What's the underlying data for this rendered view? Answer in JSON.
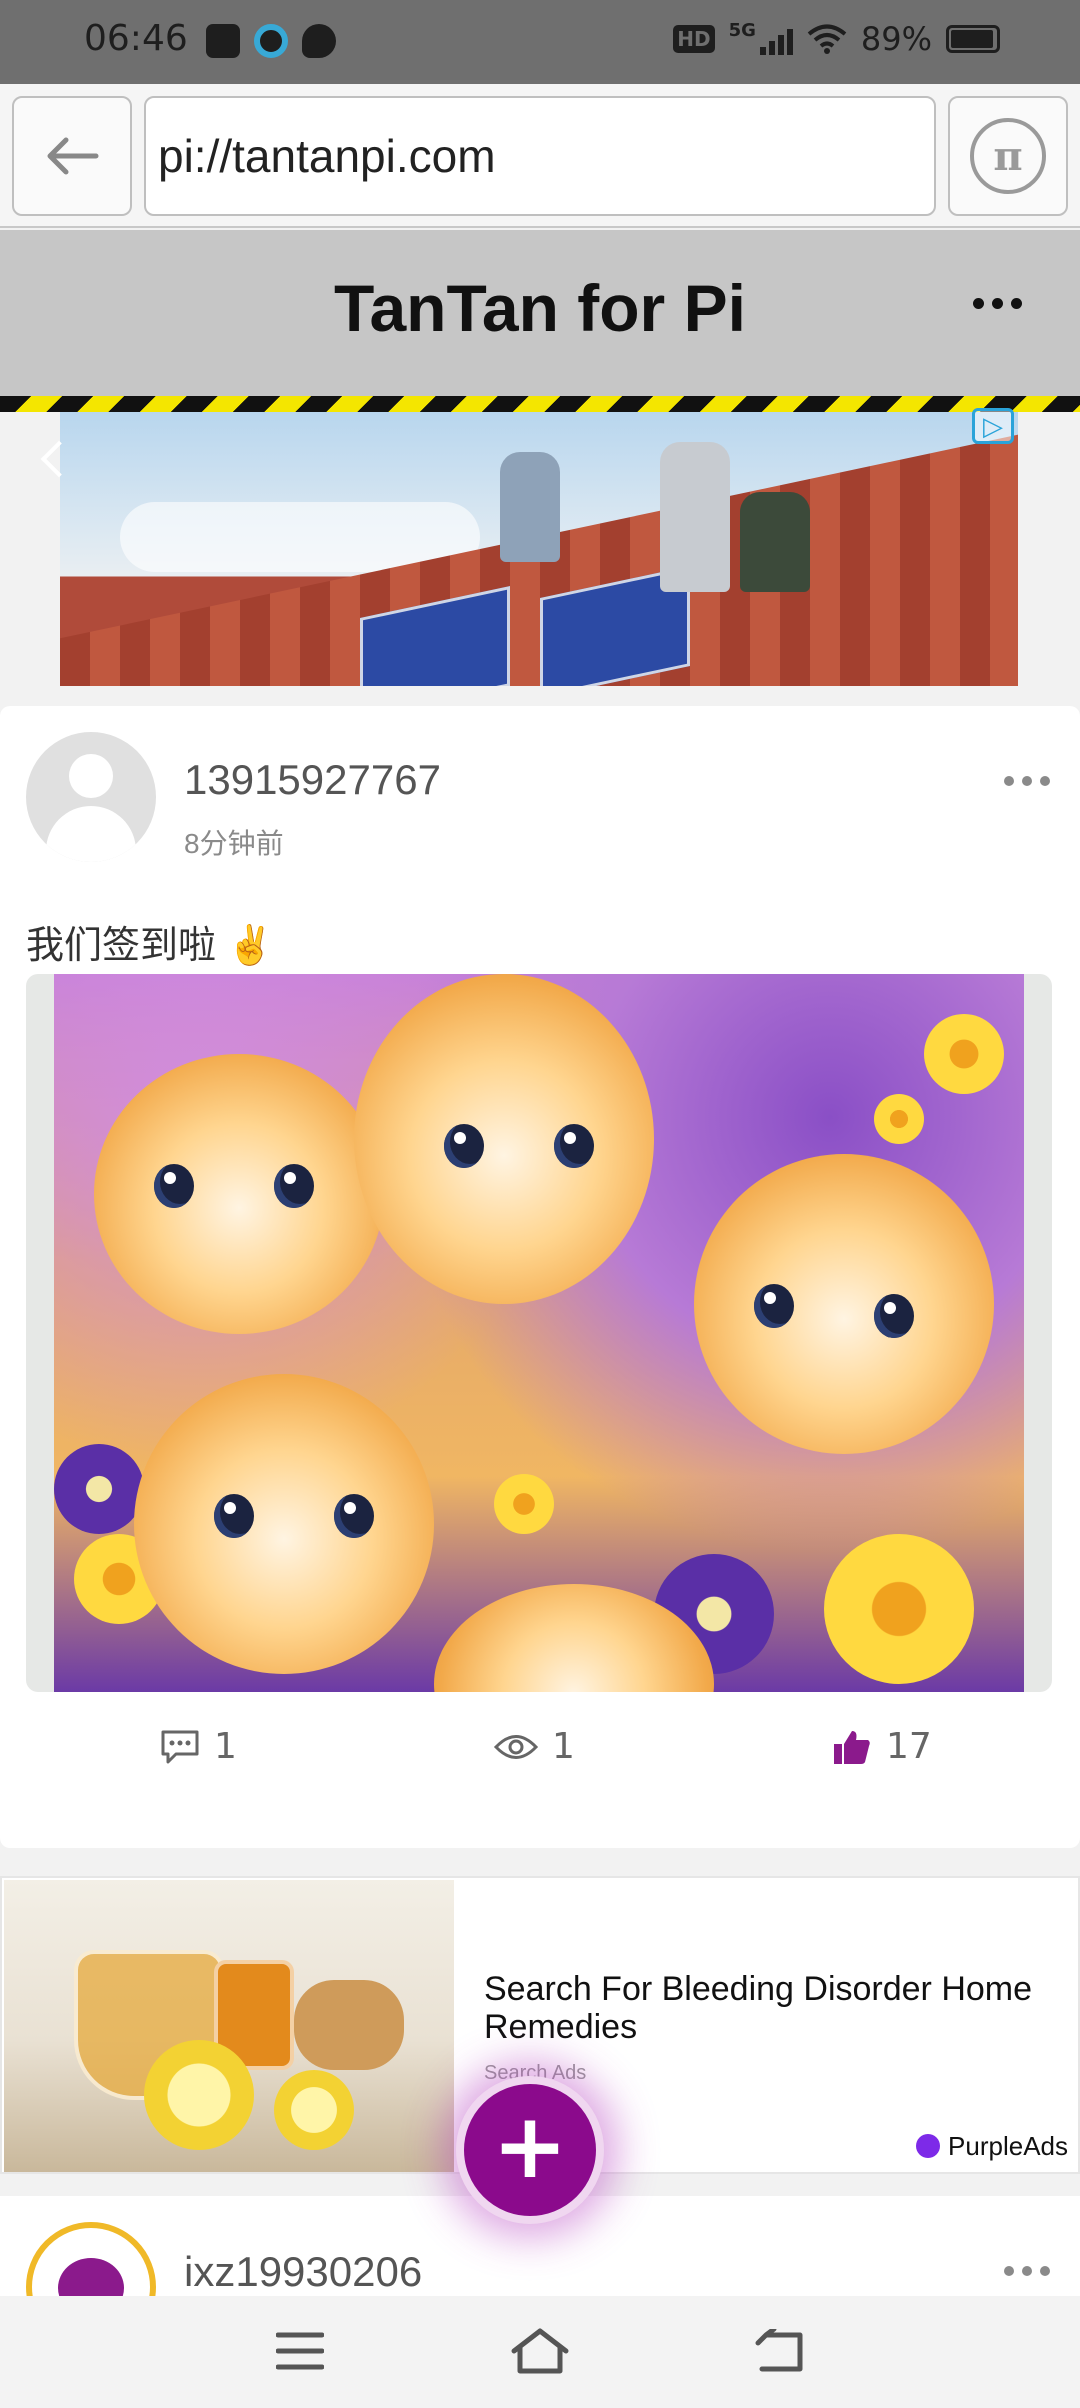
{
  "status_bar": {
    "time": "06:46",
    "left_icons": [
      "gallery-icon",
      "camera-circle-icon",
      "chat-bubble-icon"
    ],
    "network": "5G",
    "hd_badge": "HD",
    "battery": "89%"
  },
  "browser": {
    "url": "pi://tantanpi.com",
    "back_icon": "arrow-left-icon",
    "pi_icon": "pi-logo-icon",
    "pi_glyph": "π"
  },
  "app": {
    "title": "TanTan for Pi"
  },
  "post": {
    "username": "13915927767",
    "time_ago": "8分钟前",
    "text": "我们签到啦 ✌️",
    "comments": "1",
    "views": "1",
    "likes": "17",
    "like_color": "#8b1a8c"
  },
  "ad": {
    "title": "Search For Bleeding Disorder Home Remedies",
    "subtitle": "Search Ads",
    "badge": "PurpleAds"
  },
  "next_post": {
    "username": "ixz19930206"
  },
  "fab": {
    "label": "+",
    "color": "#8b0a8c"
  }
}
